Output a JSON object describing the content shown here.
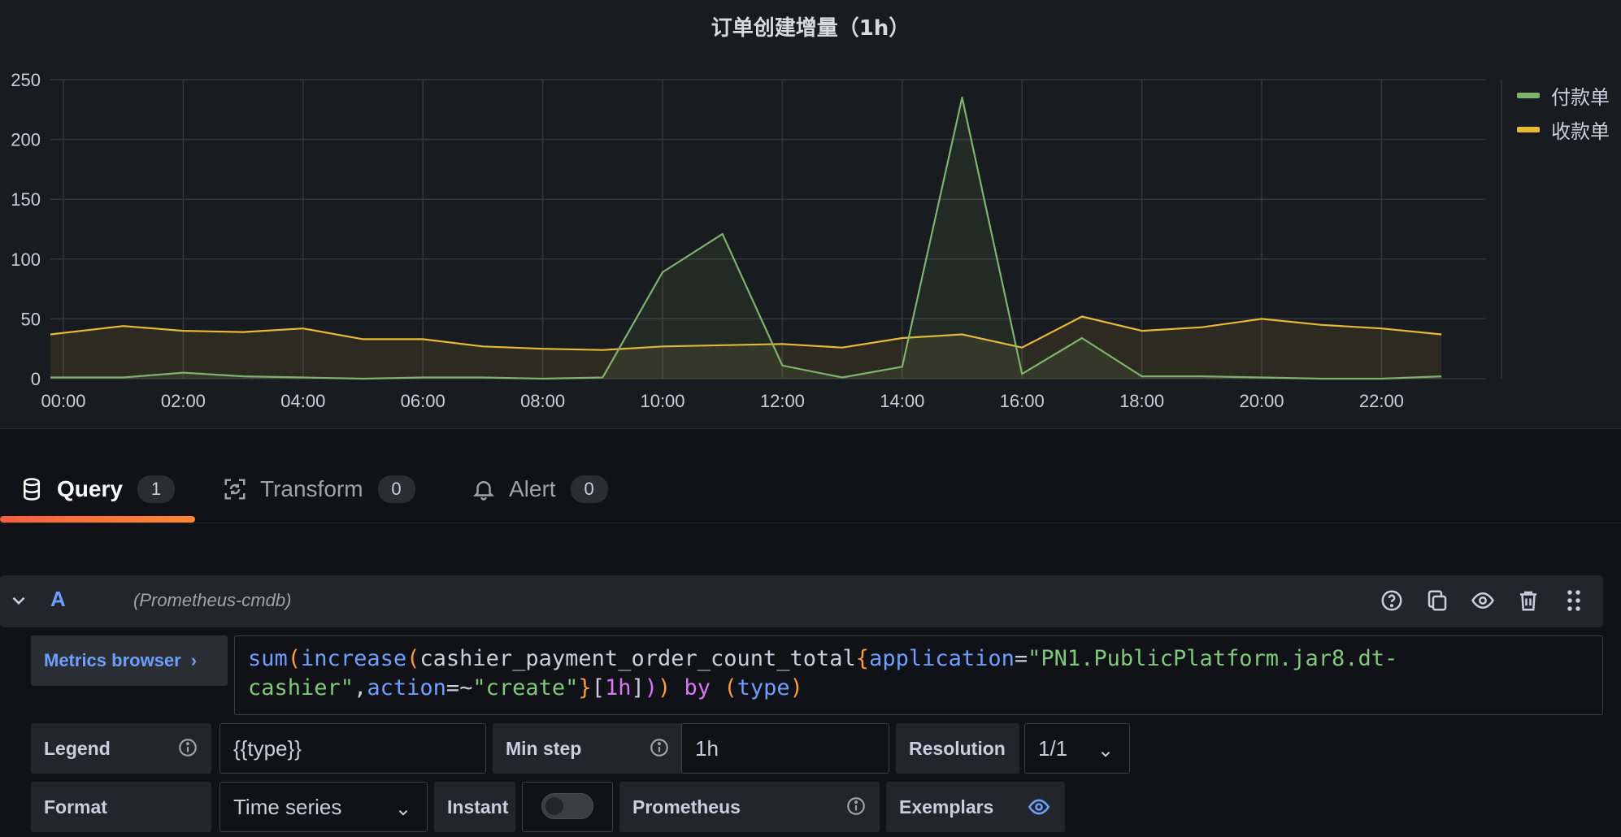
{
  "panel": {
    "title": "订单创建增量（1h）"
  },
  "chart_data": {
    "type": "area",
    "title": "订单创建增量（1h）",
    "x_labels": [
      "00:00",
      "02:00",
      "04:00",
      "06:00",
      "08:00",
      "10:00",
      "12:00",
      "14:00",
      "16:00",
      "18:00",
      "20:00",
      "22:00"
    ],
    "ylim": [
      0,
      250
    ],
    "y_ticks": [
      0,
      50,
      100,
      150,
      200,
      250
    ],
    "grid": true,
    "legend_position": "right",
    "x_hours": [
      0,
      1,
      2,
      3,
      4,
      5,
      6,
      7,
      8,
      9,
      10,
      11,
      12,
      13,
      14,
      15,
      16,
      17,
      18,
      19,
      20,
      21,
      22,
      23
    ],
    "series": [
      {
        "name": "付款单",
        "color": "#7eb26d",
        "values": [
          1,
          1,
          5,
          2,
          1,
          0,
          1,
          1,
          0,
          1,
          89,
          121,
          11,
          1,
          10,
          235,
          4,
          34,
          2,
          2,
          1,
          0,
          0,
          2
        ]
      },
      {
        "name": "收款单",
        "color": "#eab839",
        "values": [
          37,
          44,
          40,
          39,
          42,
          33,
          33,
          27,
          25,
          24,
          27,
          28,
          29,
          26,
          34,
          37,
          26,
          52,
          40,
          43,
          50,
          45,
          42,
          37
        ]
      }
    ]
  },
  "tabs": [
    {
      "label": "Query",
      "count": "1",
      "icon": "database-icon"
    },
    {
      "label": "Transform",
      "count": "0",
      "icon": "transform-icon"
    },
    {
      "label": "Alert",
      "count": "0",
      "icon": "bell-icon"
    }
  ],
  "query": {
    "ref_id": "A",
    "datasource": "(Prometheus-cmdb)",
    "metrics_browser_label": "Metrics browser",
    "expr_line1_parts": {
      "sum": "sum",
      "increase": "increase",
      "metric": "cashier_payment_order_count_total",
      "label1": "application",
      "value1": "\"PN1.PublicPlatform.jar8.dt-"
    },
    "expr_line2_parts": {
      "value1_cont": "cashier\"",
      "label2": "action",
      "op2": "=~",
      "value2": "\"create\"",
      "range": "1h",
      "by": "by",
      "group": "type"
    },
    "legend_label": "Legend",
    "legend_value": "{{type}}",
    "minstep_label": "Min step",
    "minstep_value": "1h",
    "resolution_label": "Resolution",
    "resolution_value": "1/1",
    "format_label": "Format",
    "format_value": "Time series",
    "instant_label": "Instant",
    "prometheus_label": "Prometheus",
    "exemplars_label": "Exemplars"
  }
}
